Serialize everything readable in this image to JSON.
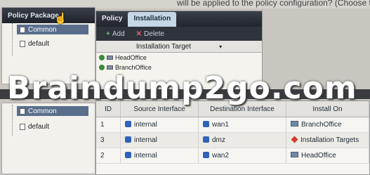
{
  "top_caption": "will be applied to the policy configuration? (Choose two)",
  "top_panel": {
    "tree": {
      "header": "Policy Package",
      "nodes": [
        "Common",
        "default"
      ]
    },
    "tabs": [
      "Policy",
      "Installation"
    ],
    "toolbar": {
      "add": "Add",
      "delete": "Delete"
    },
    "targets_header": "Installation Target",
    "targets": [
      "HeadOffice",
      "BranchOffice"
    ]
  },
  "watermark": "Braindump2go.com",
  "bottom_panel": {
    "tree": {
      "nodes": [
        "Common",
        "default"
      ]
    },
    "columns": [
      "ID",
      "Source Interface",
      "Destination Interface",
      "Install On"
    ],
    "rows": [
      {
        "id": "1",
        "src": "internal",
        "dst": "wan1",
        "install_on": "BranchOffice"
      },
      {
        "id": "3",
        "src": "internal",
        "dst": "dmz",
        "install_on": "Installation Targets"
      },
      {
        "id": "2",
        "src": "internal",
        "dst": "wan2",
        "install_on": "HeadOffice"
      }
    ]
  },
  "colors": {
    "accent_blue": "#2f63b8",
    "warning_red": "#d33a2c",
    "enabled_green": "#3b8b3b"
  }
}
